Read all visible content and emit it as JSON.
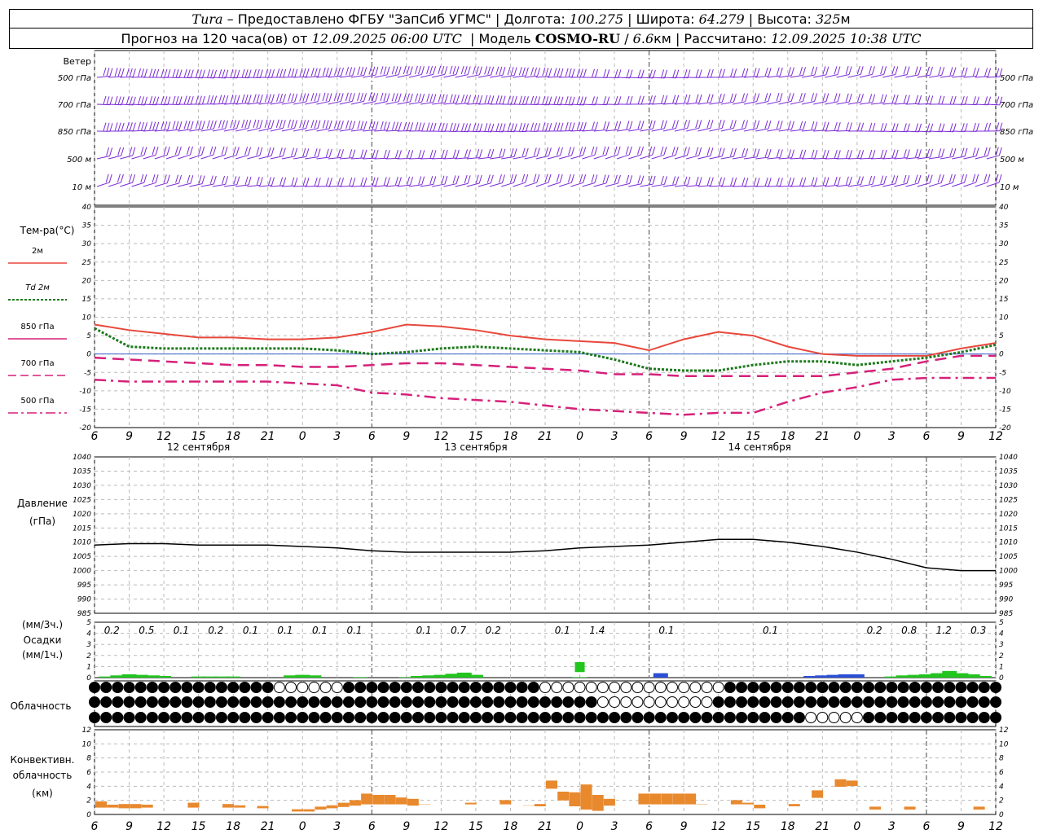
{
  "header": {
    "station": "Tura",
    "line1_rest": " – Предоставлено ФГБУ \"ЗапСиб УГМС\" | Долгота: ",
    "lon": "100.275",
    "lat_label": " | Широта: ",
    "lat": "64.279",
    "alt_label": " | Высота: ",
    "alt": "325",
    "alt_unit": "м",
    "l2_a": "Прогноз на 120 часа(ов) от ",
    "forecast_from": "12.09.2025 06:00 UTC",
    "l2_b": "  | Модель ",
    "model": "COSMO-RU",
    "l2_c": " / ",
    "res": "6.6",
    "res_unit": "км",
    "l2_d": " | Рассчитано: ",
    "computed": "12.09.2025 10:38 UTC"
  },
  "wind_panel": {
    "title": "Ветер",
    "levels": [
      "500 гПа",
      "700 гПа",
      "850 гПа",
      "500 м",
      "10  м"
    ],
    "right_levels": [
      "500 гПа",
      "700 гПа",
      "850 гПа",
      "500 м",
      "10 м"
    ],
    "color": "#7b2ad6"
  },
  "temp_panel": {
    "title": "Тем-ра(°С)",
    "legend": [
      {
        "label": "2м",
        "color": "#e8473b",
        "dash": "solid"
      },
      {
        "label": "Td  2м",
        "color": "#1e7a1e",
        "dash": "dotted"
      },
      {
        "label": "850 гПа",
        "color": "#d6207a",
        "dash": "solid"
      },
      {
        "label": "700 гПа",
        "color": "#d6207a",
        "dash": "dash"
      },
      {
        "label": "500 гПа",
        "color": "#d6207a",
        "dash": "dashdot"
      }
    ],
    "yticks": [
      "40",
      "35",
      "30",
      "25",
      "20",
      "15",
      "10",
      "5",
      "0",
      "-5",
      "-10",
      "-15",
      "-20"
    ]
  },
  "time_axis": {
    "hour_labels": [
      "6",
      "9",
      "12",
      "15",
      "18",
      "21",
      "0",
      "3",
      "6",
      "9",
      "12",
      "15",
      "18",
      "21",
      "0",
      "3",
      "6",
      "9",
      "12",
      "15",
      "18",
      "21",
      "0",
      "3",
      "6",
      "9",
      "12"
    ],
    "day_labels": [
      "12 сентября",
      "13 сентября",
      "14 сентября"
    ]
  },
  "pressure_panel": {
    "title": "Давление",
    "unit": "(гПа)",
    "yticks": [
      "1040",
      "1035",
      "1030",
      "1025",
      "1020",
      "1015",
      "1010",
      "1005",
      "1000",
      "995",
      "990",
      "985"
    ]
  },
  "precip_panel": {
    "unit3": "(мм/3ч.)",
    "title": "Осадки",
    "unit1": "(мм/1ч.)",
    "yticks": [
      "5",
      "4",
      "3",
      "2",
      "1",
      "0"
    ],
    "totals": [
      "0.2",
      "0.5",
      "0.1",
      "0.2",
      "0.1",
      "0.1",
      "0.1",
      "0.1",
      "0.1",
      "0.7",
      "0.2",
      "0.1",
      "1.4",
      "0.1",
      "0.1",
      "0.2",
      "0.8",
      "1.2",
      "0.3"
    ]
  },
  "cloud_panel": {
    "title": "Облачность"
  },
  "conv_panel": {
    "title1": "Конвективн.",
    "title2": "облачность",
    "unit": "(км)",
    "yticks": [
      "12",
      "10",
      "8",
      "6",
      "4",
      "2",
      "0"
    ],
    "color": "#e8892e"
  },
  "chart_data": [
    {
      "type": "line",
      "title": "Тем-ра(°С)",
      "x_hours_from_start": [
        0,
        3,
        6,
        9,
        12,
        15,
        18,
        21,
        24,
        27,
        30,
        33,
        36,
        39,
        42,
        45,
        48,
        51,
        54,
        57,
        60,
        63,
        66,
        69,
        72,
        75,
        78
      ],
      "ylim": [
        -20,
        40
      ],
      "series": [
        {
          "name": "2м",
          "values": [
            8,
            6.5,
            5.5,
            4.5,
            4.5,
            4,
            4,
            4.5,
            6,
            8,
            7.5,
            6.5,
            5,
            4,
            3.5,
            3,
            1,
            4,
            6,
            5,
            2,
            0,
            -0.5,
            -0.5,
            -0.5,
            1.5,
            3
          ]
        },
        {
          "name": "Td  2м",
          "values": [
            7,
            2,
            1.5,
            1.5,
            1.5,
            1.5,
            1.5,
            1,
            0,
            0.5,
            1.5,
            2,
            1.5,
            1,
            0.5,
            -1.5,
            -4,
            -4.5,
            -4.5,
            -3,
            -2,
            -2,
            -3,
            -2,
            -1,
            0.5,
            2.5
          ]
        },
        {
          "name": "850 гПа",
          "values": [
            -1,
            -1.5,
            -2,
            -2.5,
            -3,
            -3,
            -3.5,
            -3.5,
            -3,
            -2.5,
            -2.5,
            -3,
            -3.5,
            -4,
            -4.5,
            -5.5,
            -5.5,
            -6,
            -6,
            -6,
            -6,
            -6,
            -5,
            -4,
            -2,
            -0.5,
            -0.5
          ]
        },
        {
          "name": "700 гПа",
          "values": [
            -7,
            -7.5,
            -7.5,
            -7.5,
            -7.5,
            -7.5,
            -8,
            -8.5,
            -10.5,
            -11,
            -12,
            -12.5,
            -13,
            -14,
            -15,
            -15.5,
            -16,
            -16.5,
            -16,
            -16,
            -13,
            -10.5,
            -9,
            -7,
            -6.5,
            -6.5,
            -6.5
          ]
        }
      ]
    },
    {
      "type": "line",
      "title": "Давление",
      "ylim": [
        985,
        1040
      ],
      "x_hours_from_start": [
        0,
        3,
        6,
        9,
        12,
        15,
        18,
        21,
        24,
        27,
        30,
        33,
        36,
        39,
        42,
        45,
        48,
        51,
        54,
        57,
        60,
        63,
        66,
        69,
        72,
        75,
        78
      ],
      "series": [
        {
          "name": "",
          "values": [
            1009,
            1009.5,
            1009.5,
            1009,
            1009,
            1009,
            1008.5,
            1008,
            1007,
            1006.5,
            1006.5,
            1006.5,
            1006.5,
            1007,
            1008,
            1008.5,
            1009,
            1010,
            1011,
            1011,
            1010,
            1008.5,
            1006.5,
            1004,
            1001,
            1000,
            1000
          ]
        }
      ]
    },
    {
      "type": "bar",
      "title": "Осадки",
      "ylim": [
        0,
        5
      ],
      "categories_3h_totals": [
        "0.2",
        "0.5",
        "0.1",
        "0.2",
        "0.1",
        "0.1",
        "0.1",
        "0.1",
        "0.1",
        "0.7",
        "0.2",
        "0.1",
        "1.4",
        "0.1",
        "0.1",
        "0.2",
        "0.8",
        "1.2",
        "0.3"
      ]
    },
    {
      "type": "bar",
      "title": "Конвективн. облачность",
      "ylim": [
        0,
        13
      ]
    }
  ]
}
